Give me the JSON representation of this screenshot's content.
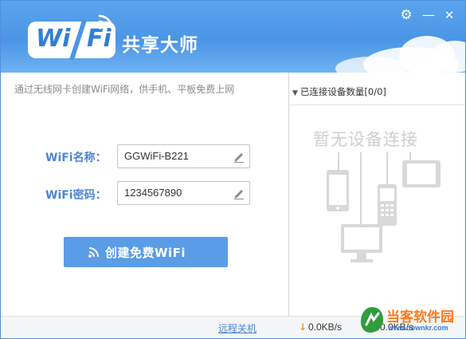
{
  "app": {
    "logo_wi": "Wi",
    "logo_fi": "Fi",
    "name": "共享大师"
  },
  "window_controls": {
    "settings_icon": "gear-icon",
    "minimize_label": "—",
    "close_label": "✕"
  },
  "main": {
    "subtitle": "通过无线网卡创建WiFi网络，供手机、平板免费上网",
    "wifi_name_label": "WiFi名称：",
    "wifi_name_value": "GGWiFi-B221",
    "wifi_password_label": "WiFi密码：",
    "wifi_password_value": "1234567890",
    "create_button_label": "创建免费WiFi",
    "edit_icon": "pencil-icon",
    "wifi_icon": "wifi-signal-icon"
  },
  "devices": {
    "header_label": "已连接设备数量[0/0]",
    "empty_text": "暂无设备连接",
    "icons": [
      "phone-icon",
      "tablet-icon",
      "feature-phone-icon",
      "monitor-icon"
    ]
  },
  "status": {
    "remote_shutdown_label": "远程关机",
    "download_arrow": "↓",
    "download_speed": "0.0KB/s",
    "upload_speed": "0.0KB/s"
  },
  "watermark": {
    "text": "当客软件园",
    "url": "www.downkr.com"
  },
  "colors": {
    "header_blue": "#4b95e6",
    "accent_blue": "#4b86d8",
    "button_blue": "#5a9ce6",
    "placeholder_gray": "#cfcfcf",
    "watermark_orange": "#ff7a1a"
  }
}
